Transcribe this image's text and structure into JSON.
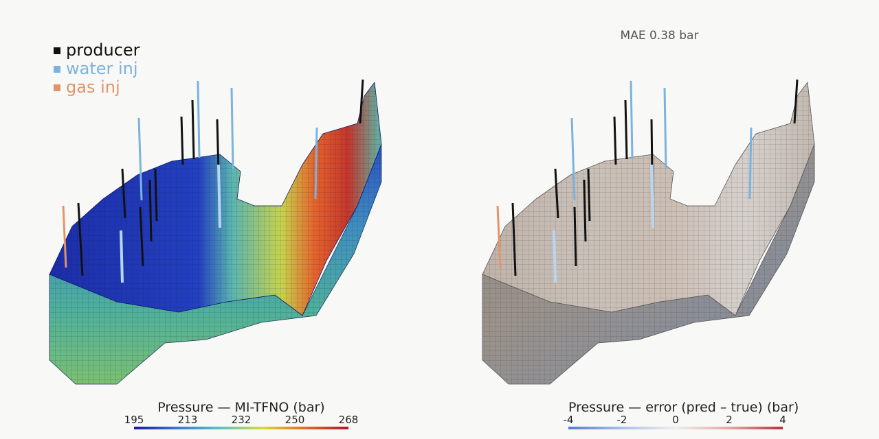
{
  "legend": [
    {
      "label": "producer",
      "color": "#111111"
    },
    {
      "label": "water inj",
      "color": "#7ab3e0"
    },
    {
      "label": "gas inj",
      "color": "#e3936a"
    }
  ],
  "left_panel": {
    "colorbar": {
      "title": "Pressure — MI-TFNO (bar)",
      "ticks": [
        "195",
        "213",
        "232",
        "250",
        "268"
      ],
      "colors": [
        "#1a1a9c",
        "#3a78d8",
        "#59c3c3",
        "#d9d93a",
        "#e36a2a",
        "#b2182b"
      ]
    }
  },
  "right_panel": {
    "metric": "MAE 0.38 bar",
    "colorbar": {
      "title": "Pressure — error (pred – true) (bar)",
      "ticks": [
        "-4",
        "-2",
        "0",
        "2",
        "4"
      ],
      "colors": [
        "#5b7ad0",
        "#a9c0ea",
        "#eeeeee",
        "#e5a9a0",
        "#b4353a"
      ]
    }
  }
}
